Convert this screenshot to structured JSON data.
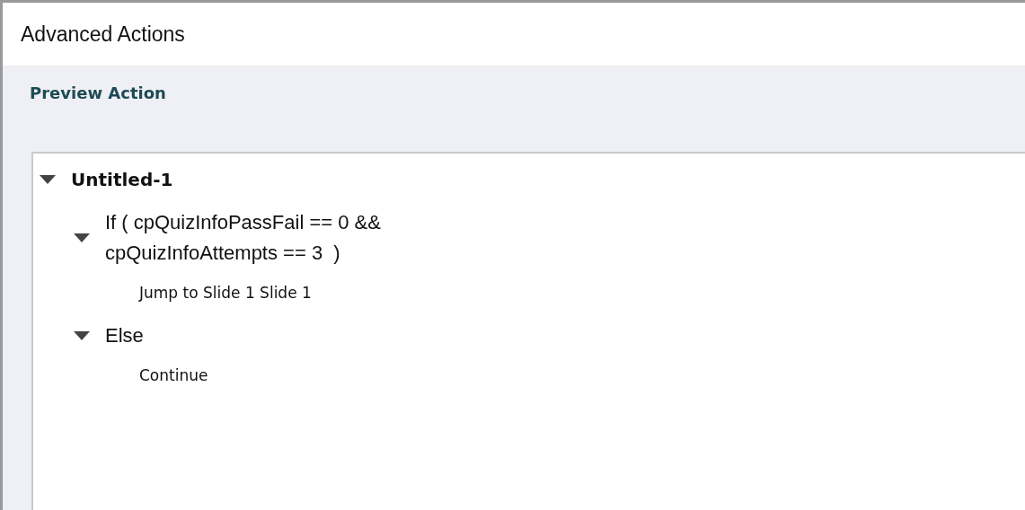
{
  "window": {
    "title": "Advanced Actions"
  },
  "section": {
    "title": "Preview Action"
  },
  "tree": [
    {
      "kind": "root",
      "label": "Untitled-1",
      "expanded": true,
      "children": [
        {
          "kind": "branch",
          "label": "If ( cpQuizInfoPassFail == 0 &&\ncpQuizInfoAttempts == 3  )",
          "expanded": true,
          "children": [
            {
              "kind": "action",
              "label": "Jump to Slide 1 Slide 1"
            }
          ]
        },
        {
          "kind": "branch",
          "label": "Else",
          "expanded": true,
          "children": [
            {
              "kind": "action",
              "label": "Continue"
            }
          ]
        }
      ]
    }
  ]
}
